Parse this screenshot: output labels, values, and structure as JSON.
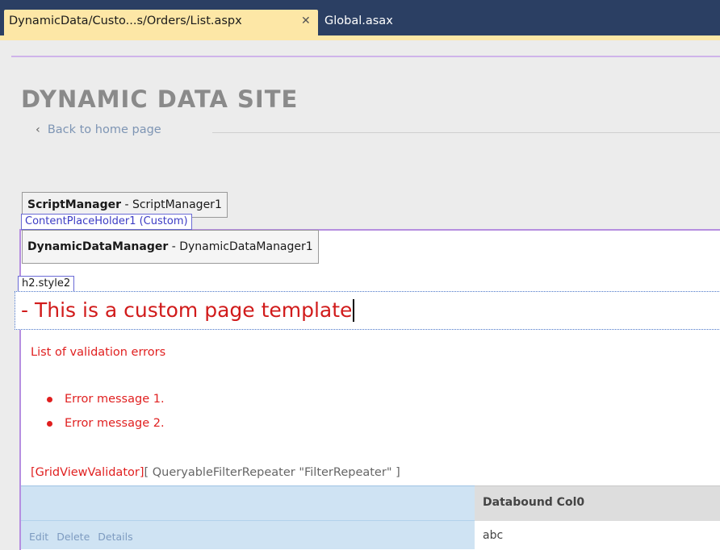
{
  "tabs": {
    "active": {
      "label": "DynamicData/Custo...s/Orders/List.aspx",
      "close": "✕"
    },
    "inactive": {
      "label": "Global.asax"
    }
  },
  "page": {
    "site_title": "DYNAMIC DATA SITE",
    "back_chevron": "‹",
    "back_link": "Back to home page"
  },
  "controls": {
    "script_manager": {
      "type": "ScriptManager",
      "separator": " - ",
      "id": "ScriptManager1"
    },
    "content_placeholder": "ContentPlaceHolder1 (Custom)",
    "dynamic_data_manager": {
      "type": "DynamicDataManager",
      "separator": " - ",
      "id": "DynamicDataManager1"
    }
  },
  "heading": {
    "tag": "h2.style2",
    "text": "- This is a custom page template"
  },
  "validation": {
    "title": "List of validation errors",
    "errors": [
      "Error message 1.",
      "Error message 2."
    ]
  },
  "gridview_line": {
    "validator": "[GridViewValidator]",
    "filter": "[ QueryableFilterRepeater \"FilterRepeater\" ]"
  },
  "grid": {
    "column_header": "Databound Col0",
    "row_actions": [
      "Edit",
      "Delete",
      "Details"
    ],
    "row_value": "abc"
  }
}
